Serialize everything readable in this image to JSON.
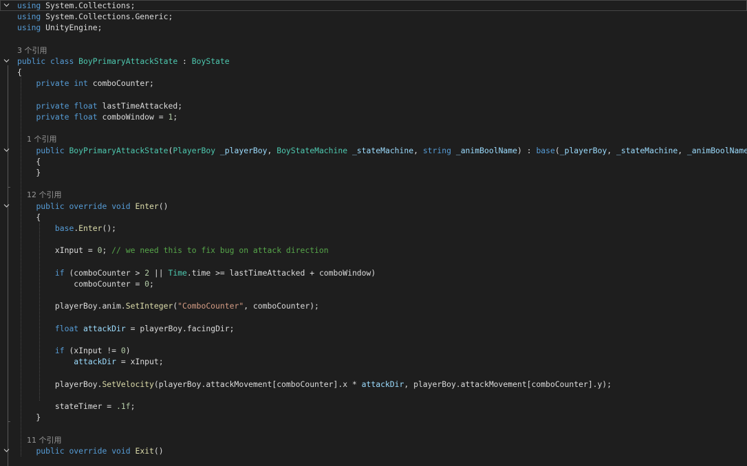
{
  "editor": {
    "theme": {
      "background": "#1e1e1e",
      "keyword": "#569cd6",
      "type": "#4ec9b0",
      "identifier": "#dcdcdc",
      "method": "#dcdcaa",
      "parameter": "#9cdcfe",
      "string": "#d69d85",
      "number": "#b5cea8",
      "comment": "#57a64a",
      "code_lens": "#999999"
    },
    "lines": [
      {
        "fold": true,
        "current": true,
        "tokens": [
          {
            "t": "using",
            "c": "k"
          },
          {
            "t": " System.Collections;",
            "c": "p"
          }
        ]
      },
      {
        "tokens": [
          {
            "t": "using",
            "c": "k"
          },
          {
            "t": " System.Collections.Generic;",
            "c": "p"
          }
        ]
      },
      {
        "tokens": [
          {
            "t": "using",
            "c": "k"
          },
          {
            "t": " UnityEngine;",
            "c": "p"
          }
        ]
      },
      {
        "tokens": []
      },
      {
        "lens": "3 个引用"
      },
      {
        "fold": true,
        "tokens": [
          {
            "t": "public",
            "c": "k"
          },
          {
            "t": " ",
            "c": "p"
          },
          {
            "t": "class",
            "c": "k"
          },
          {
            "t": " ",
            "c": "p"
          },
          {
            "t": "BoyPrimaryAttackState",
            "c": "ty"
          },
          {
            "t": " : ",
            "c": "p"
          },
          {
            "t": "BoyState",
            "c": "ty"
          }
        ]
      },
      {
        "tokens": [
          {
            "t": "{",
            "c": "p"
          }
        ]
      },
      {
        "tokens": [
          {
            "t": "    ",
            "c": "p"
          },
          {
            "t": "private",
            "c": "k"
          },
          {
            "t": " ",
            "c": "p"
          },
          {
            "t": "int",
            "c": "k"
          },
          {
            "t": " comboCounter;",
            "c": "p"
          }
        ]
      },
      {
        "tokens": []
      },
      {
        "tokens": [
          {
            "t": "    ",
            "c": "p"
          },
          {
            "t": "private",
            "c": "k"
          },
          {
            "t": " ",
            "c": "p"
          },
          {
            "t": "float",
            "c": "k"
          },
          {
            "t": " lastTimeAttacked;",
            "c": "p"
          }
        ]
      },
      {
        "tokens": [
          {
            "t": "    ",
            "c": "p"
          },
          {
            "t": "private",
            "c": "k"
          },
          {
            "t": " ",
            "c": "p"
          },
          {
            "t": "float",
            "c": "k"
          },
          {
            "t": " comboWindow = ",
            "c": "p"
          },
          {
            "t": "1",
            "c": "n"
          },
          {
            "t": ";",
            "c": "p"
          }
        ]
      },
      {
        "tokens": []
      },
      {
        "lens": "    1 个引用"
      },
      {
        "fold": true,
        "tokens": [
          {
            "t": "    ",
            "c": "p"
          },
          {
            "t": "public",
            "c": "k"
          },
          {
            "t": " ",
            "c": "p"
          },
          {
            "t": "BoyPrimaryAttackState",
            "c": "ty"
          },
          {
            "t": "(",
            "c": "p"
          },
          {
            "t": "PlayerBoy",
            "c": "ty"
          },
          {
            "t": " ",
            "c": "p"
          },
          {
            "t": "_playerBoy",
            "c": "pa"
          },
          {
            "t": ", ",
            "c": "p"
          },
          {
            "t": "BoyStateMachine",
            "c": "ty"
          },
          {
            "t": " ",
            "c": "p"
          },
          {
            "t": "_stateMachine",
            "c": "pa"
          },
          {
            "t": ", ",
            "c": "p"
          },
          {
            "t": "string",
            "c": "k"
          },
          {
            "t": " ",
            "c": "p"
          },
          {
            "t": "_animBoolName",
            "c": "pa"
          },
          {
            "t": ") : ",
            "c": "p"
          },
          {
            "t": "base",
            "c": "k"
          },
          {
            "t": "(",
            "c": "p"
          },
          {
            "t": "_playerBoy",
            "c": "pa"
          },
          {
            "t": ", ",
            "c": "p"
          },
          {
            "t": "_stateMachine",
            "c": "pa"
          },
          {
            "t": ", ",
            "c": "p"
          },
          {
            "t": "_animBoolName",
            "c": "pa"
          },
          {
            "t": ")",
            "c": "p"
          }
        ]
      },
      {
        "tokens": [
          {
            "t": "    {",
            "c": "p"
          }
        ]
      },
      {
        "tokens": [
          {
            "t": "    }",
            "c": "p"
          }
        ]
      },
      {
        "tokens": []
      },
      {
        "lens": "    12 个引用"
      },
      {
        "fold": true,
        "tokens": [
          {
            "t": "    ",
            "c": "p"
          },
          {
            "t": "public",
            "c": "k"
          },
          {
            "t": " ",
            "c": "p"
          },
          {
            "t": "override",
            "c": "k"
          },
          {
            "t": " ",
            "c": "p"
          },
          {
            "t": "void",
            "c": "k"
          },
          {
            "t": " ",
            "c": "p"
          },
          {
            "t": "Enter",
            "c": "m"
          },
          {
            "t": "()",
            "c": "p"
          }
        ]
      },
      {
        "tokens": [
          {
            "t": "    {",
            "c": "p"
          }
        ]
      },
      {
        "tokens": [
          {
            "t": "        ",
            "c": "p"
          },
          {
            "t": "base",
            "c": "k"
          },
          {
            "t": ".",
            "c": "p"
          },
          {
            "t": "Enter",
            "c": "m"
          },
          {
            "t": "();",
            "c": "p"
          }
        ]
      },
      {
        "tokens": []
      },
      {
        "tokens": [
          {
            "t": "        xInput = ",
            "c": "p"
          },
          {
            "t": "0",
            "c": "n"
          },
          {
            "t": "; ",
            "c": "p"
          },
          {
            "t": "// we need this to fix bug on attack direction",
            "c": "cm"
          }
        ]
      },
      {
        "tokens": []
      },
      {
        "tokens": [
          {
            "t": "        ",
            "c": "p"
          },
          {
            "t": "if",
            "c": "k"
          },
          {
            "t": " (comboCounter > ",
            "c": "p"
          },
          {
            "t": "2",
            "c": "n"
          },
          {
            "t": " || ",
            "c": "p"
          },
          {
            "t": "Time",
            "c": "ty"
          },
          {
            "t": ".time >= lastTimeAttacked + comboWindow)",
            "c": "p"
          }
        ]
      },
      {
        "tokens": [
          {
            "t": "            comboCounter = ",
            "c": "p"
          },
          {
            "t": "0",
            "c": "n"
          },
          {
            "t": ";",
            "c": "p"
          }
        ]
      },
      {
        "tokens": []
      },
      {
        "tokens": [
          {
            "t": "        playerBoy.anim.",
            "c": "p"
          },
          {
            "t": "SetInteger",
            "c": "m"
          },
          {
            "t": "(",
            "c": "p"
          },
          {
            "t": "\"ComboCounter\"",
            "c": "s"
          },
          {
            "t": ", comboCounter);",
            "c": "p"
          }
        ]
      },
      {
        "tokens": []
      },
      {
        "tokens": [
          {
            "t": "        ",
            "c": "p"
          },
          {
            "t": "float",
            "c": "k"
          },
          {
            "t": " ",
            "c": "p"
          },
          {
            "t": "attackDir",
            "c": "pa"
          },
          {
            "t": " = playerBoy.facingDir;",
            "c": "p"
          }
        ]
      },
      {
        "tokens": []
      },
      {
        "tokens": [
          {
            "t": "        ",
            "c": "p"
          },
          {
            "t": "if",
            "c": "k"
          },
          {
            "t": " (xInput != ",
            "c": "p"
          },
          {
            "t": "0",
            "c": "n"
          },
          {
            "t": ")",
            "c": "p"
          }
        ]
      },
      {
        "tokens": [
          {
            "t": "            ",
            "c": "p"
          },
          {
            "t": "attackDir",
            "c": "pa"
          },
          {
            "t": " = xInput;",
            "c": "p"
          }
        ]
      },
      {
        "tokens": []
      },
      {
        "tokens": [
          {
            "t": "        playerBoy.",
            "c": "p"
          },
          {
            "t": "SetVelocity",
            "c": "m"
          },
          {
            "t": "(playerBoy.attackMovement[comboCounter].x * ",
            "c": "p"
          },
          {
            "t": "attackDir",
            "c": "pa"
          },
          {
            "t": ", playerBoy.attackMovement[comboCounter].y);",
            "c": "p"
          }
        ]
      },
      {
        "tokens": []
      },
      {
        "tokens": [
          {
            "t": "        stateTimer = ",
            "c": "p"
          },
          {
            "t": ".1f",
            "c": "n"
          },
          {
            "t": ";",
            "c": "p"
          }
        ]
      },
      {
        "tokens": [
          {
            "t": "    }",
            "c": "p"
          }
        ]
      },
      {
        "tokens": []
      },
      {
        "lens": "    11 个引用"
      },
      {
        "fold": true,
        "tokens": [
          {
            "t": "    ",
            "c": "p"
          },
          {
            "t": "public",
            "c": "k"
          },
          {
            "t": " ",
            "c": "p"
          },
          {
            "t": "override",
            "c": "k"
          },
          {
            "t": " ",
            "c": "p"
          },
          {
            "t": "void",
            "c": "k"
          },
          {
            "t": " ",
            "c": "p"
          },
          {
            "t": "Exit",
            "c": "m"
          },
          {
            "t": "()",
            "c": "p"
          }
        ]
      }
    ]
  }
}
